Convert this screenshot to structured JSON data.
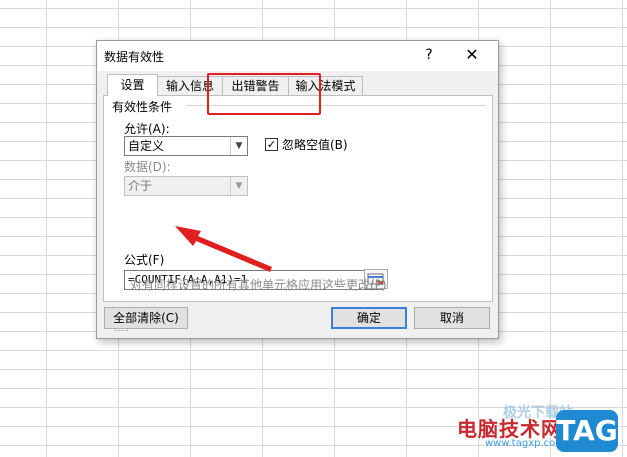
{
  "dialog": {
    "title": "数据有效性",
    "help_label": "?",
    "close_label": "✕"
  },
  "tabs": [
    {
      "label": "设置",
      "active": true
    },
    {
      "label": "输入信息",
      "active": false
    },
    {
      "label": "出错警告",
      "active": false
    },
    {
      "label": "输入法模式",
      "active": false
    }
  ],
  "settings": {
    "group_title": "有效性条件",
    "allow_label": "允许(A):",
    "allow_value": "自定义",
    "ignore_blank_label": "忽略空值(B)",
    "ignore_blank_checked": true,
    "data_label": "数据(D):",
    "data_value": "介于",
    "formula_label": "公式(F)",
    "formula_value": "=COUNTIF(A:A,A1)=1",
    "apply_all_label": "对有同样设置的所有其他单元格应用这些更改(P)",
    "apply_all_checked": false
  },
  "buttons": {
    "clear_all": "全部清除(C)",
    "ok": "确定",
    "cancel": "取消"
  },
  "watermark": {
    "site_name": "电脑技术网",
    "url": "www.tagxp.com",
    "tag": "TAG",
    "top_text": "极光下载站"
  },
  "colors": {
    "annotation_red": "#e02020",
    "default_button_border": "#3c7fd6",
    "tag_blue": "#1f8ad2"
  }
}
